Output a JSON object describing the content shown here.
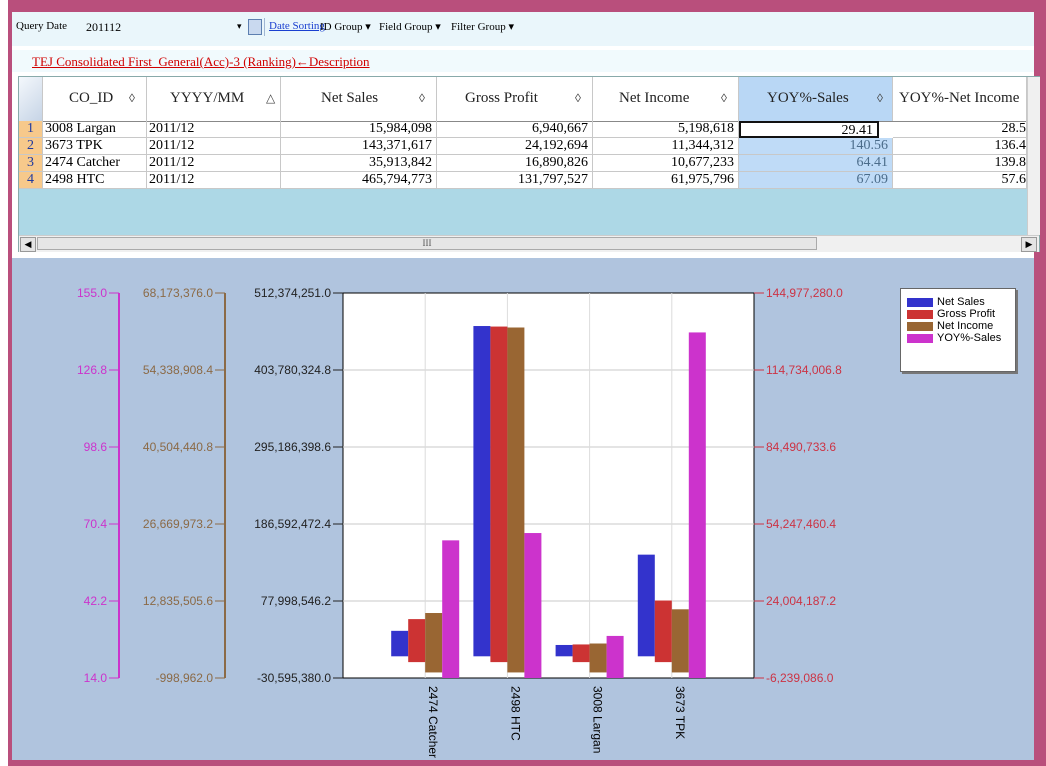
{
  "toolbar": {
    "query_date_label": "Query Date",
    "query_date_value": "201112",
    "date_sorting": "Date Sorting",
    "id_group": "ID Group",
    "field_group": "Field Group",
    "filter_group": "Filter Group",
    "dropdown_glyph": "▾"
  },
  "description_link": "TEJ Consolidated First_General(Acc)-3 (Ranking)←Description",
  "grid": {
    "columns": [
      {
        "label": "CO_ID",
        "sort": "◊"
      },
      {
        "label": "YYYY/MM",
        "sort": "△"
      },
      {
        "label": "Net Sales",
        "sort": "◊"
      },
      {
        "label": "Gross Profit",
        "sort": "◊"
      },
      {
        "label": "Net Income",
        "sort": "◊"
      },
      {
        "label": "YOY%-Sales",
        "sort": "◊"
      },
      {
        "label": "YOY%-Net Income",
        "sort": ""
      }
    ],
    "rows": [
      {
        "num": "1",
        "co_id": "3008 Largan",
        "ym": "2011/12",
        "net_sales": "15,984,098",
        "gross_profit": "6,940,667",
        "net_income": "5,198,618",
        "yoy_sales": "29.41",
        "yoy_net": "28.5"
      },
      {
        "num": "2",
        "co_id": "3673 TPK",
        "ym": "2011/12",
        "net_sales": "143,371,617",
        "gross_profit": "24,192,694",
        "net_income": "11,344,312",
        "yoy_sales": "140.56",
        "yoy_net": "136.4"
      },
      {
        "num": "3",
        "co_id": "2474 Catcher",
        "ym": "2011/12",
        "net_sales": "35,913,842",
        "gross_profit": "16,890,826",
        "net_income": "10,677,233",
        "yoy_sales": "64.41",
        "yoy_net": "139.8"
      },
      {
        "num": "4",
        "co_id": "2498 HTC",
        "ym": "2011/12",
        "net_sales": "465,794,773",
        "gross_profit": "131,797,527",
        "net_income": "61,975,796",
        "yoy_sales": "67.09",
        "yoy_net": "57.6"
      }
    ],
    "scroll_glyph": "III"
  },
  "chart_data": {
    "type": "bar",
    "categories": [
      "2474 Catcher",
      "2498 HTC",
      "3008 Largan",
      "3673 TPK"
    ],
    "series": [
      {
        "name": "Net Sales",
        "color": "#3333cc",
        "axis": "net_sales",
        "values": [
          35913842,
          465794773,
          15984098,
          143371617
        ]
      },
      {
        "name": "Gross Profit",
        "color": "#cc3333",
        "axis": "gross_profit",
        "values": [
          16890826,
          131797527,
          6940667,
          24192694
        ]
      },
      {
        "name": "Net Income",
        "color": "#996633",
        "axis": "net_income",
        "values": [
          10677233,
          61975796,
          5198618,
          11344312
        ]
      },
      {
        "name": "YOY%-Sales",
        "color": "#cc33cc",
        "axis": "yoy",
        "values": [
          64.41,
          67.09,
          29.41,
          140.56
        ]
      }
    ],
    "axes": {
      "yoy": {
        "color": "#cc33cc",
        "ylim": [
          14.0,
          155.0
        ],
        "ticks": [
          "155.0",
          "126.8",
          "98.6",
          "70.4",
          "42.2",
          "14.0"
        ]
      },
      "net_income": {
        "color": "#8b6a46",
        "ylim": [
          -998962.0,
          68173376.0
        ],
        "ticks": [
          "68,173,376.0",
          "54,338,908.4",
          "40,504,440.8",
          "26,669,973.2",
          "12,835,505.6",
          "-998,962.0"
        ]
      },
      "net_sales": {
        "color": "#222222",
        "ylim": [
          -30595380.0,
          512374251.0
        ],
        "ticks": [
          "512,374,251.0",
          "403,780,324.8",
          "295,186,398.6",
          "186,592,472.4",
          "77,998,546.2",
          "-30,595,380.0"
        ]
      },
      "gross_profit": {
        "color": "#cc3344",
        "ylim": [
          -6239086.0,
          144977280.0
        ],
        "ticks": [
          "144,977,280.0",
          "114,734,006.8",
          "84,490,733.6",
          "54,247,460.4",
          "24,004,187.2",
          "-6,239,086.0"
        ]
      }
    },
    "grid": true,
    "legend_position": "top-right"
  }
}
